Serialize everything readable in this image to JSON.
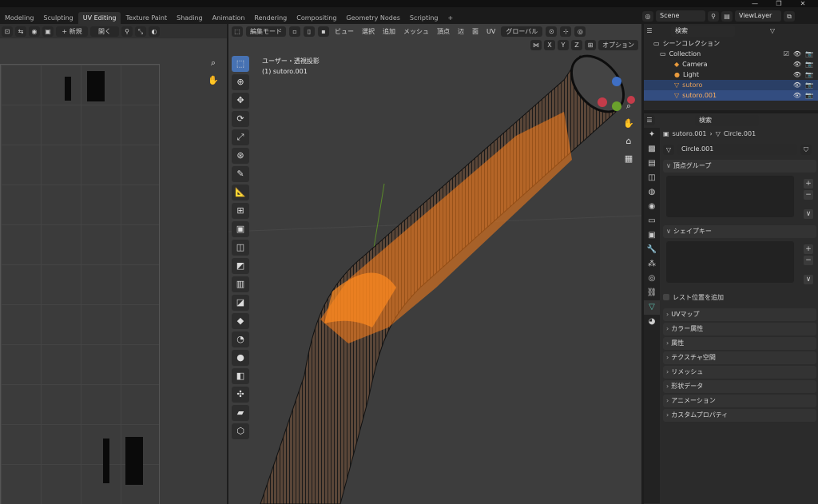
{
  "window": {
    "minimize": "—",
    "maximize": "❐",
    "close": "✕"
  },
  "workspace_tabs": [
    "Modeling",
    "Sculpting",
    "UV Editing",
    "Texture Paint",
    "Shading",
    "Animation",
    "Rendering",
    "Compositing",
    "Geometry Nodes",
    "Scripting",
    "+"
  ],
  "active_tab": "UV Editing",
  "scene": {
    "name": "Scene",
    "view_layer": "ViewLayer"
  },
  "uv_editor": {
    "new_label": "+ 新規",
    "open_label": "開く"
  },
  "viewport": {
    "mode": "編集モード",
    "menus": [
      "ビュー",
      "選択",
      "追加",
      "メッシュ",
      "頂点",
      "辺",
      "面",
      "UV"
    ],
    "transform": "グローバル",
    "options_label": "オプション",
    "axes": [
      "X",
      "Y",
      "Z"
    ],
    "info_line1": "ユーザー・透視投影",
    "info_line2": "(1) sutoro.001",
    "accent_orange": "#ff7f1a",
    "active_tool_color": "#4772b3"
  },
  "outliner": {
    "search_placeholder": "検索",
    "root": "シーンコレクション",
    "collection": "Collection",
    "items": [
      "Camera",
      "Light",
      "sutoro",
      "sutoro.001"
    ]
  },
  "properties": {
    "search_placeholder": "検索",
    "breadcrumb_object": "sutoro.001",
    "breadcrumb_data": "Circle.001",
    "data_name": "Circle.001",
    "vertex_groups": "頂点グループ",
    "shape_keys": "シェイプキー",
    "rest_position": "レスト位置を追加",
    "sections": [
      "UVマップ",
      "カラー属性",
      "属性",
      "テクスチャ空間",
      "リメッシュ",
      "形状データ",
      "アニメーション",
      "カスタムプロパティ"
    ]
  }
}
